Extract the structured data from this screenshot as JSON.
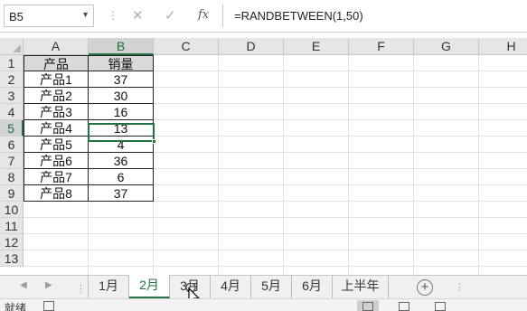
{
  "formula_bar": {
    "name_box": "B5",
    "name_box_dropdown_icon": "chevron-down-icon",
    "cancel_icon": "close-icon",
    "enter_icon": "checkmark-icon",
    "fx_label": "fx",
    "formula": "=RANDBETWEEN(1,50)"
  },
  "columns": [
    "A",
    "B",
    "C",
    "D",
    "E",
    "F",
    "G",
    "H"
  ],
  "rows": [
    "1",
    "2",
    "3",
    "4",
    "5",
    "6",
    "7",
    "8",
    "9",
    "10",
    "11",
    "12",
    "13"
  ],
  "selected_cell": {
    "column": "B",
    "row": "5"
  },
  "table": {
    "headers": [
      "产品",
      "销量"
    ],
    "rows": [
      [
        "产品1",
        "37"
      ],
      [
        "产品2",
        "30"
      ],
      [
        "产品3",
        "16"
      ],
      [
        "产品4",
        "13"
      ],
      [
        "产品5",
        "4"
      ],
      [
        "产品6",
        "36"
      ],
      [
        "产品7",
        "6"
      ],
      [
        "产品8",
        "37"
      ]
    ]
  },
  "sheet_tabs": {
    "tabs": [
      "1月",
      "2月",
      "3月",
      "4月",
      "5月",
      "6月",
      "上半年"
    ],
    "active": "2月",
    "add_icon": "plus-circle-icon"
  },
  "status_bar": {
    "ready": "就绪",
    "macro_icon": "record-macro-icon",
    "views": [
      "normal-view-icon",
      "page-layout-icon",
      "page-break-icon"
    ]
  },
  "colors": {
    "accent": "#217346",
    "header_fill": "#d9d9d9",
    "chrome": "#f0f0f0"
  }
}
